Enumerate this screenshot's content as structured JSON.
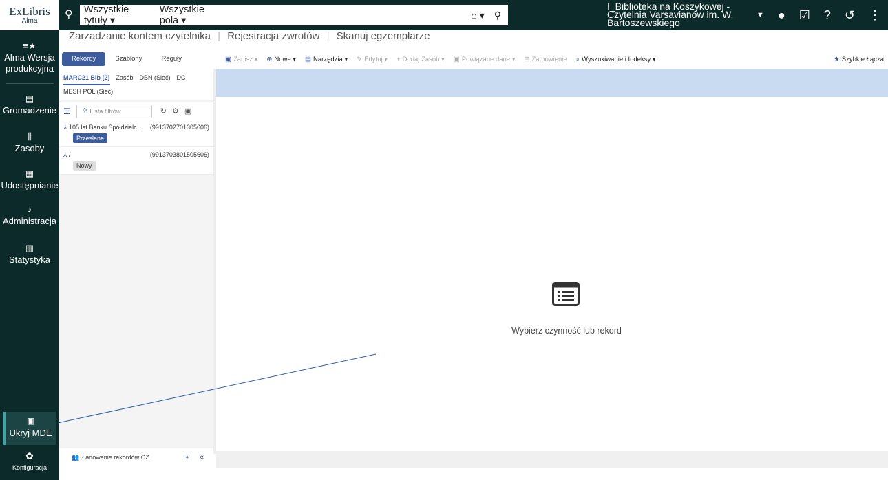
{
  "logo": {
    "ex": "ExLibris",
    "alma": "Alma"
  },
  "leftnav": {
    "items": [
      {
        "icon": "≡★",
        "label_1": "Alma Wersja",
        "label_2": "produkcyjna"
      },
      {
        "icon": "▤",
        "label": "Gromadzenie"
      },
      {
        "icon": "⫼",
        "label": "Zasoby"
      },
      {
        "icon": "▦",
        "label": "Udostępnianie"
      },
      {
        "icon": "♪",
        "label": "Administracja"
      },
      {
        "icon": "▥",
        "label": "Statystyka"
      }
    ],
    "mde": {
      "icon": "▣",
      "label": "Ukryj MDE"
    },
    "config": {
      "icon": "✿",
      "label": "Konfiguracja"
    }
  },
  "topbar": {
    "scope_1": "Wszystkie tytuły ▾",
    "scope_2": "Wszystkie pola ▾",
    "search_value": "",
    "library_line_1": "I_Biblioteka na Koszykowej -",
    "library_line_2": "Czytelnia Varsavianów im. W.",
    "library_line_3": "Bartoszewskiego"
  },
  "subnav": {
    "items": [
      "Zarządzanie kontem czytelnika",
      "Rejestracja zwrotów",
      "Skanuj egzemplarze"
    ]
  },
  "toolbar": {
    "mode_tabs": [
      "Rekordy",
      "Szablony",
      "Reguły"
    ],
    "actions": [
      {
        "icon": "▣",
        "label": "Zapisz ▾",
        "enabled": false
      },
      {
        "icon": "⊕",
        "label": "Nowe ▾",
        "enabled": true
      },
      {
        "icon": "▤",
        "label": "Narzędzia ▾",
        "enabled": true
      },
      {
        "icon": "✎",
        "label": "Edytuj ▾",
        "enabled": false
      },
      {
        "icon": "+",
        "label": "Dodaj Zasób ▾",
        "enabled": false
      },
      {
        "icon": "▣",
        "label": "Powiązane dane ▾",
        "enabled": false
      },
      {
        "icon": "⊟",
        "label": "Zamówienie",
        "enabled": false
      },
      {
        "icon": "⌕",
        "label": "Wyszukiwanie i Indeksy ▾",
        "enabled": true
      }
    ],
    "quick_links": "Szybkie Łącza"
  },
  "left_panel": {
    "tabs_row_1": [
      "MARC21 Bib (2)",
      "Zasób",
      "DBN (Sieć)",
      "DC"
    ],
    "tabs_row_2": [
      "MESH POL (Sieć)"
    ],
    "filter_placeholder": "Lista filtrów",
    "records": [
      {
        "title": "105 lat Banku Spółdzielc...",
        "id": "(9913702701305606)",
        "badge": "Przesłane"
      },
      {
        "title": "/",
        "id": "(9913703801505606)",
        "badge": "Nowy"
      }
    ],
    "footer": "Ładowanie rekordów CZ"
  },
  "main": {
    "empty_text": "Wybierz czynność lub rekord"
  }
}
